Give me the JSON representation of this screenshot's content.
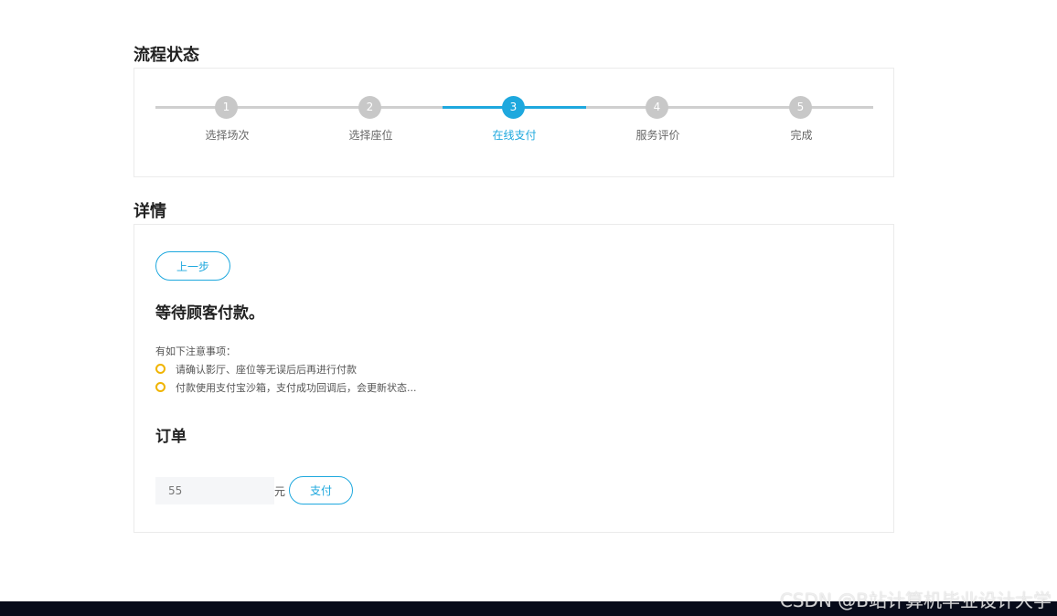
{
  "process": {
    "title": "流程状态",
    "steps": [
      {
        "number": "1",
        "label": "选择场次"
      },
      {
        "number": "2",
        "label": "选择座位"
      },
      {
        "number": "3",
        "label": "在线支付"
      },
      {
        "number": "4",
        "label": "服务评价"
      },
      {
        "number": "5",
        "label": "完成"
      }
    ],
    "active_step": 3
  },
  "details": {
    "title": "详情",
    "prev_button": "上一步",
    "waiting_heading": "等待顾客付款。",
    "notes_intro": "有如下注意事项：",
    "notes": [
      "请确认影厅、座位等无误后后再进行付款",
      "付款使用支付宝沙箱，支付成功回调后，会更新状态..."
    ],
    "order_heading": "订单",
    "amount_value": "55",
    "amount_unit": "元",
    "pay_button": "支付"
  },
  "colors": {
    "accent": "#1ea8de",
    "inactive": "#c8c8c8",
    "note_dot": "#f0b400"
  },
  "watermark": "CSDN @B站计算机毕业设计大学"
}
